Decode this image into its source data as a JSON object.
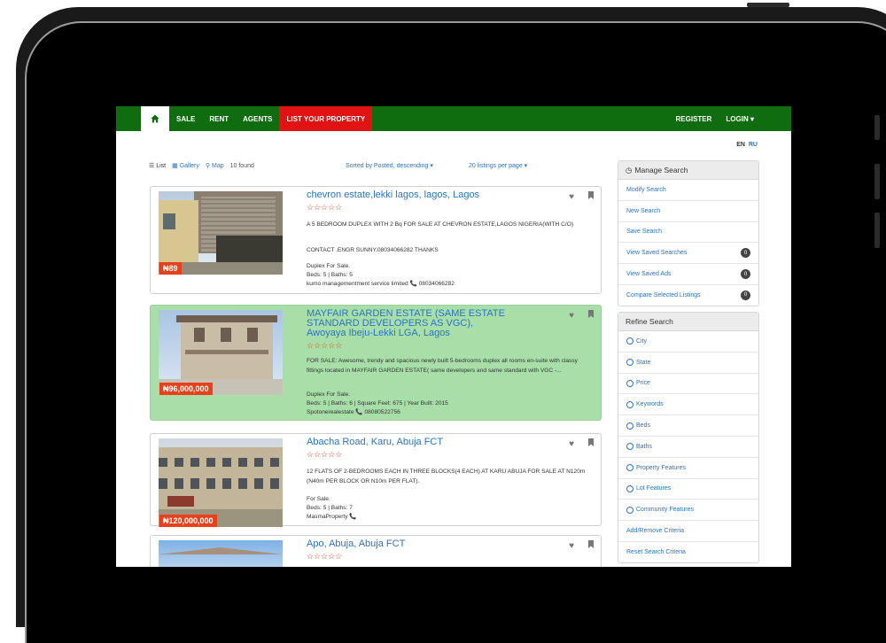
{
  "nav": {
    "home_icon": "home-icon",
    "items": [
      "SALE",
      "RENT",
      "AGENTS",
      "LIST YOUR PROPERTY"
    ],
    "right_items": [
      "REGISTER",
      "LOGIN ▾"
    ]
  },
  "lang": {
    "en": "EN",
    "ru": "RU"
  },
  "toolbar": {
    "list": "List",
    "gallery": "Gallery",
    "map": "Map",
    "found": "10 found",
    "sort": "Sorted by Posted, descending ▾",
    "per_page": "20 listings per page ▾"
  },
  "listings": [
    {
      "title": "chevron estate,lekki lagos, lagos, Lagos",
      "stars": "☆☆☆☆☆",
      "desc": "A 5 BEDROOM DUPLEX WITH 2 Bq FOR SALE AT CHEVRON ESTATE,LAGOS NIGERIA(WITH C/O)",
      "desc2": "CONTACT .ENGR SUNNY,08034066282 THANKS",
      "type": "Duplex For Sale.",
      "specs": "Beds: 5 | Baths: 5",
      "agent": "kumo managementment service limited",
      "phone": "08034066282",
      "price": "₦89"
    },
    {
      "title": "MAYFAIR GARDEN ESTATE (SAME ESTATE STANDARD DEVELOPERS AS VGC), Awoyaya Ibeju-Lekki LGA, Lagos",
      "stars": "☆☆☆☆☆",
      "desc": "FOR SALE: Awesome, trendy and spacious newly built 5-bedrooms duplex all rooms en-suite with classy fittings located in MAYFAIR GARDEN ESTATE( same developers and same standard with VGC -...",
      "type": "Duplex For Sale.",
      "specs": "Beds: 5 | Baths: 6 | Square Feet: 675 | Year Built: 2015",
      "agent": "Spotonerealestate",
      "phone": "08080522756",
      "price": "₦96,000,000"
    },
    {
      "title": "Abacha Road, Karu, Abuja FCT",
      "stars": "☆☆☆☆☆",
      "desc": "12 FLATS OF 2-BEDROOMS EACH IN THREE BLOCKS(4 EACH) AT KARU ABUJA FOR SALE AT N120m (N40m PER BLOCK OR N10m PER FLAT).",
      "type": "For Sale.",
      "specs": "Beds: 5 | Baths: 7",
      "agent": "MasmaProperty",
      "phone": "",
      "price": "₦120,000,000"
    },
    {
      "title": "Apo, Abuja, Abuja FCT",
      "stars": "☆☆☆☆☆"
    }
  ],
  "manage": {
    "heading": "Manage Search",
    "items": [
      {
        "label": "Modify Search",
        "badge": ""
      },
      {
        "label": "New Search",
        "badge": ""
      },
      {
        "label": "Save Search",
        "badge": ""
      },
      {
        "label": "View Saved Searches",
        "badge": "0"
      },
      {
        "label": "View Saved Ads",
        "badge": "0"
      },
      {
        "label": "Compare Selected Listings",
        "badge": "0"
      }
    ]
  },
  "refine": {
    "heading": "Refine Search",
    "items": [
      "City",
      "State",
      "Price",
      "Keywords",
      "Beds",
      "Baths",
      "Property Features",
      "Lot Features",
      "Community Features"
    ],
    "add_remove": "Add/Remove Criteria",
    "reset": "Reset Search Criteria"
  },
  "colors": {
    "nav_green": "#0f6d0f",
    "accent_red": "#e01212",
    "link_blue": "#2a72c8",
    "highlight_green": "#a8dfa8",
    "price_orange": "#e8401a"
  }
}
